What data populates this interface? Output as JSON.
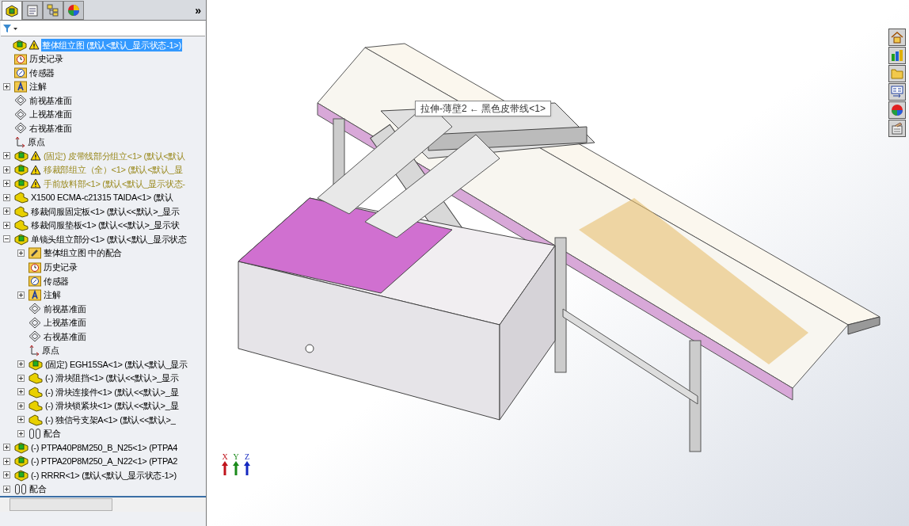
{
  "panel_tabs": [
    {
      "kind": "assembly",
      "selected": true
    },
    {
      "kind": "properties",
      "selected": false
    },
    {
      "kind": "config",
      "selected": false
    },
    {
      "kind": "display",
      "selected": false
    }
  ],
  "panel_more": "»",
  "tree": [
    {
      "kind": "assembly",
      "label": "整体组立图  (默认<默认_显示状态-1>)",
      "warning": true,
      "selected": true,
      "expanded": true,
      "children": [
        {
          "kind": "history",
          "label": "历史记录",
          "warning": false,
          "selected": false
        },
        {
          "kind": "sensor",
          "label": "传感器",
          "warning": false,
          "selected": false
        },
        {
          "kind": "annotation",
          "label": "注解",
          "warning": false,
          "selected": false,
          "expanded": false
        },
        {
          "kind": "plane",
          "label": "前视基准面",
          "warning": false,
          "selected": false
        },
        {
          "kind": "plane",
          "label": "上视基准面",
          "warning": false,
          "selected": false
        },
        {
          "kind": "plane",
          "label": "右视基准面",
          "warning": false,
          "selected": false
        },
        {
          "kind": "origin",
          "label": "原点",
          "warning": false,
          "selected": false
        },
        {
          "kind": "assembly",
          "label": "(固定) 皮带线部分组立<1> (默认<默认",
          "warning": true,
          "selected": false,
          "expanded": false
        },
        {
          "kind": "assembly",
          "label": "移裁部组立（全）<1> (默认<默认_显",
          "warning": true,
          "selected": false,
          "expanded": false
        },
        {
          "kind": "assembly",
          "label": "手前放料部<1> (默认<默认_显示状态-",
          "warning": true,
          "selected": false,
          "expanded": false
        },
        {
          "kind": "part",
          "label": "X1500 ECMA-c21315 TAIDA<1> (默认",
          "warning": false,
          "selected": false,
          "expanded": false
        },
        {
          "kind": "part",
          "label": "移裁伺服固定板<1> (默认<<默认>_显示",
          "warning": false,
          "selected": false,
          "expanded": false
        },
        {
          "kind": "part",
          "label": "移裁伺服垫板<1> (默认<<默认>_显示状",
          "warning": false,
          "selected": false,
          "expanded": false
        },
        {
          "kind": "assembly",
          "label": "单镜头组立部分<1> (默认<默认_显示状态",
          "warning": false,
          "selected": false,
          "expanded": true,
          "children": [
            {
              "kind": "mates-folder",
              "label": "整体组立图 中的配合",
              "warning": false,
              "selected": false,
              "expanded": false
            },
            {
              "kind": "history",
              "label": "历史记录",
              "warning": false,
              "selected": false
            },
            {
              "kind": "sensor",
              "label": "传感器",
              "warning": false,
              "selected": false
            },
            {
              "kind": "annotation",
              "label": "注解",
              "warning": false,
              "selected": false,
              "expanded": false
            },
            {
              "kind": "plane",
              "label": "前视基准面",
              "warning": false,
              "selected": false
            },
            {
              "kind": "plane",
              "label": "上视基准面",
              "warning": false,
              "selected": false
            },
            {
              "kind": "plane",
              "label": "右视基准面",
              "warning": false,
              "selected": false
            },
            {
              "kind": "origin",
              "label": "原点",
              "warning": false,
              "selected": false
            },
            {
              "kind": "assembly",
              "label": "(固定) EGH15SA<1> (默认<默认_显示",
              "warning": false,
              "selected": false,
              "expanded": false
            },
            {
              "kind": "part",
              "label": "(-) 滑块阻挡<1> (默认<<默认>_显示",
              "warning": false,
              "selected": false,
              "expanded": false
            },
            {
              "kind": "part",
              "label": "(-) 滑块连接件<1> (默认<<默认>_显",
              "warning": false,
              "selected": false,
              "expanded": false
            },
            {
              "kind": "part",
              "label": "(-) 滑块锁紧块<1> (默认<<默认>_显",
              "warning": false,
              "selected": false,
              "expanded": false
            },
            {
              "kind": "part",
              "label": "(-) 独信号支架A<1> (默认<<默认>_",
              "warning": false,
              "selected": false,
              "expanded": false
            },
            {
              "kind": "mates",
              "label": "配合",
              "warning": false,
              "selected": false,
              "expanded": false
            }
          ]
        },
        {
          "kind": "assembly",
          "label": "(-) PTPA40P8M250_B_N25<1> (PTPA4",
          "warning": false,
          "selected": false,
          "expanded": false
        },
        {
          "kind": "assembly",
          "label": "(-) PTPA20P8M250_A_N22<1> (PTPA2",
          "warning": false,
          "selected": false,
          "expanded": false
        },
        {
          "kind": "assembly",
          "label": "(-) RRRR<1> (默认<默认_显示状态-1>)",
          "warning": false,
          "selected": false,
          "expanded": false
        },
        {
          "kind": "mates",
          "label": "配合",
          "warning": false,
          "selected": false,
          "expanded": false
        }
      ]
    }
  ],
  "tooltip": "拉伸-薄壁2 ← 黑色皮带线<1>",
  "axes": [
    {
      "label": "X",
      "color": "#c0141c"
    },
    {
      "label": "Y",
      "color": "#1a8a1a"
    },
    {
      "label": "Z",
      "color": "#1428c0"
    }
  ],
  "task_pane": [
    {
      "kind": "home"
    },
    {
      "kind": "library"
    },
    {
      "kind": "folder"
    },
    {
      "kind": "view-palette"
    },
    {
      "kind": "appearance"
    },
    {
      "kind": "custom-properties"
    }
  ]
}
